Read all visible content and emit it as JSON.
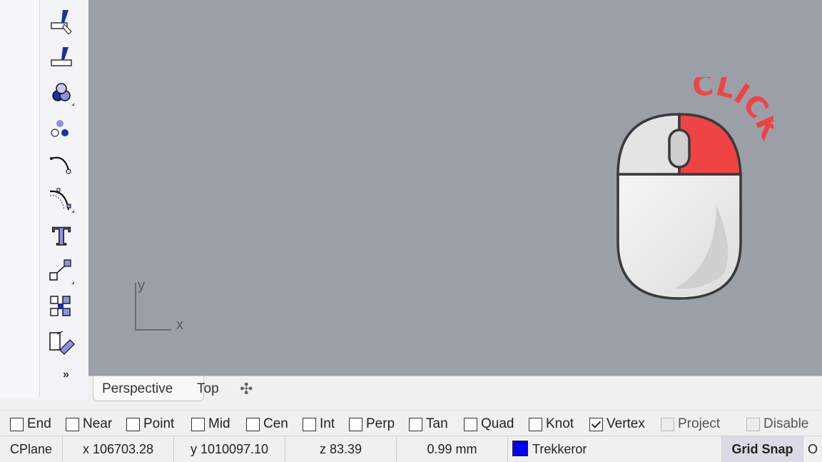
{
  "toolbar": {
    "tools": [
      {
        "name": "split-icon"
      },
      {
        "name": "trim-icon"
      },
      {
        "name": "boolean-union-icon"
      },
      {
        "name": "point-cloud-icon"
      },
      {
        "name": "curve-edit-icon"
      },
      {
        "name": "fillet-edge-icon"
      },
      {
        "name": "text-object-icon"
      },
      {
        "name": "scale-icon"
      },
      {
        "name": "group-icon"
      },
      {
        "name": "render-mesh-icon"
      }
    ],
    "more_label": "»"
  },
  "viewport": {
    "background": "#9ba0a8",
    "axis_x": "x",
    "axis_y": "y",
    "overlay_text": "CLICK",
    "overlay_color": "#f04444"
  },
  "viewport_tabs": {
    "perspective": "Perspective",
    "top": "Top",
    "add": "✣"
  },
  "osnaps": [
    {
      "label": "End",
      "checked": false,
      "enabled": true
    },
    {
      "label": "Near",
      "checked": false,
      "enabled": true
    },
    {
      "label": "Point",
      "checked": false,
      "enabled": true
    },
    {
      "label": "Mid",
      "checked": false,
      "enabled": true
    },
    {
      "label": "Cen",
      "checked": false,
      "enabled": true
    },
    {
      "label": "Int",
      "checked": false,
      "enabled": true
    },
    {
      "label": "Perp",
      "checked": false,
      "enabled": true
    },
    {
      "label": "Tan",
      "checked": false,
      "enabled": true
    },
    {
      "label": "Quad",
      "checked": false,
      "enabled": true
    },
    {
      "label": "Knot",
      "checked": false,
      "enabled": true
    },
    {
      "label": "Vertex",
      "checked": true,
      "enabled": true
    },
    {
      "label": "Project",
      "checked": false,
      "enabled": false
    },
    {
      "label": "Disable",
      "checked": false,
      "enabled": false
    }
  ],
  "status": {
    "cplane": "CPlane",
    "x": "x 106703.28",
    "y": "y 1010097.10",
    "z": "z 83.39",
    "distance": "0.99 mm",
    "layer": "Trekkeror",
    "layer_color": "#0000ff",
    "grid_snap": "Grid Snap",
    "truncated": "O"
  }
}
